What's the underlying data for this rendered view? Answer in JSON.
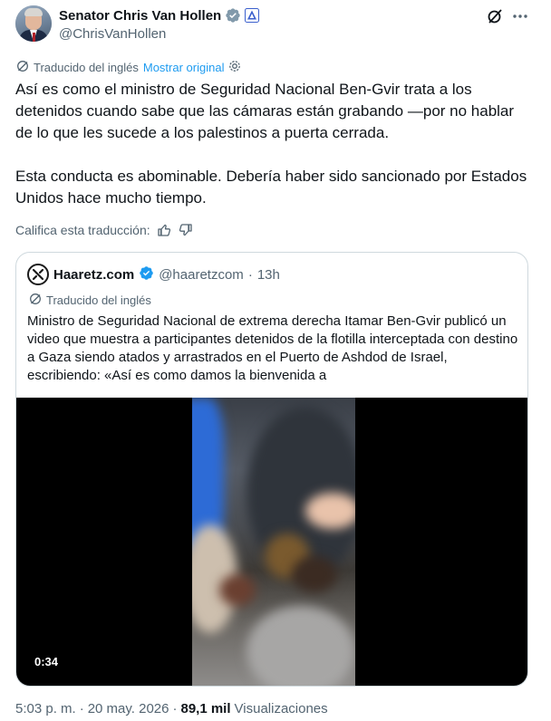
{
  "author": {
    "display_name": "Senator Chris Van Hollen",
    "handle": "@ChrisVanHollen",
    "verified_icon": "verified-badge-icon",
    "affiliate_icon": "government-affiliate-icon"
  },
  "translation": {
    "translated_label": "Traducido del inglés",
    "show_original": "Mostrar original",
    "rate_label": "Califica esta traducción:"
  },
  "tweet": {
    "paragraphs": [
      "Así es como el ministro de Seguridad Nacional Ben-Gvir trata a los detenidos cuando sabe que las cámaras están grabando —por no hablar de lo que les sucede a los palestinos a puerta cerrada.",
      "Esta conducta es abominable. Debería haber sido sancionado por Estados Unidos hace mucho tiempo."
    ]
  },
  "quote": {
    "name": "Haaretz.com",
    "handle": "@haaretzcom",
    "separator": "·",
    "time": "13h",
    "translated_label": "Traducido del inglés",
    "text": "Ministro de Seguridad Nacional de extrema derecha Itamar Ben-Gvir publicó un video que muestra a participantes detenidos de la flotilla interceptada con destino a Gaza siendo atados y arrastrados en el Puerto de Ashdod de Israel, escribiendo: «Así es como damos la bienvenida a",
    "video_duration": "0:34"
  },
  "footer": {
    "time": "5:03 p. m.",
    "separator1": "·",
    "date": "20 may. 2026",
    "separator2": "·",
    "views_count": "89,1 mil",
    "views_label": "Visualizaciones"
  },
  "colors": {
    "accent": "#1d9bf0",
    "text": "#0f1419",
    "muted": "#536471",
    "border": "#cfd9de"
  }
}
